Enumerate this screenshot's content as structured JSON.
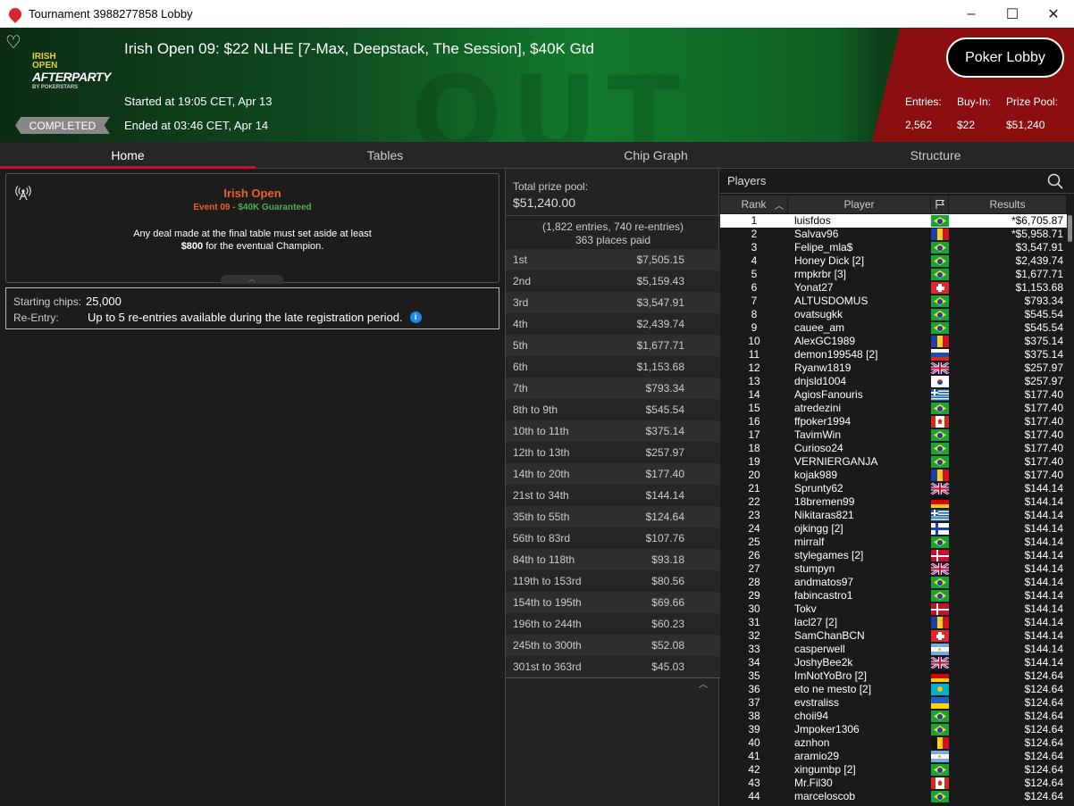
{
  "window": {
    "title": "Tournament 3988277858 Lobby",
    "controls": [
      "–",
      "☐",
      "✕"
    ]
  },
  "header": {
    "brand_line1": "IRISH",
    "brand_line2": "OPEN",
    "brand_big": "AFTERPARTY",
    "brand_small": "BY POKERSTARS",
    "status": "COMPLETED",
    "event_title": "Irish Open 09: $22 NLHE [7-Max, Deepstack, The Session], $40K Gtd",
    "started": "Started at 19:05 CET, Apr 13",
    "ended": "Ended at 03:46 CET, Apr 14",
    "lobby_button": "Poker Lobby",
    "entries_label": "Entries:",
    "entries_value": "2,562",
    "buyin_label": "Buy-In:",
    "buyin_value": "$22",
    "pool_label": "Prize Pool:",
    "pool_value": "$51,240"
  },
  "tabs": [
    "Home",
    "Tables",
    "Chip Graph",
    "Structure"
  ],
  "info": {
    "title": "Irish Open",
    "sub_a": "Event 09 - ",
    "sub_b": "$40K Guaranteed",
    "body_line1": "Any deal made at the final table must set aside at least",
    "body_amount": "$800",
    "body_line2": " for the eventual Champion.",
    "chips_label": "Starting chips:",
    "chips_value": "25,000",
    "reentry_label": "Re-Entry:",
    "reentry_value": "Up to 5 re-entries available during the late registration period."
  },
  "prizes": {
    "label": "Total prize pool:",
    "value": "$51,240.00",
    "entries_line": "(1,822 entries, 740 re-entries)",
    "places_line": "363 places paid",
    "rows": [
      {
        "place": "1st",
        "amount": "$7,505.15"
      },
      {
        "place": "2nd",
        "amount": "$5,159.43"
      },
      {
        "place": "3rd",
        "amount": "$3,547.91"
      },
      {
        "place": "4th",
        "amount": "$2,439.74"
      },
      {
        "place": "5th",
        "amount": "$1,677.71"
      },
      {
        "place": "6th",
        "amount": "$1,153.68"
      },
      {
        "place": "7th",
        "amount": "$793.34"
      },
      {
        "place": "8th to 9th",
        "amount": "$545.54"
      },
      {
        "place": "10th to 11th",
        "amount": "$375.14"
      },
      {
        "place": "12th to 13th",
        "amount": "$257.97"
      },
      {
        "place": "14th to 20th",
        "amount": "$177.40"
      },
      {
        "place": "21st to 34th",
        "amount": "$144.14"
      },
      {
        "place": "35th to 55th",
        "amount": "$124.64"
      },
      {
        "place": "56th to 83rd",
        "amount": "$107.76"
      },
      {
        "place": "84th to 118th",
        "amount": "$93.18"
      },
      {
        "place": "119th to 153rd",
        "amount": "$80.56"
      },
      {
        "place": "154th to 195th",
        "amount": "$69.66"
      },
      {
        "place": "196th to 244th",
        "amount": "$60.23"
      },
      {
        "place": "245th to 300th",
        "amount": "$52.08"
      },
      {
        "place": "301st to 363rd",
        "amount": "$45.03"
      }
    ]
  },
  "players": {
    "title": "Players",
    "col_rank": "Rank",
    "col_player": "Player",
    "col_results": "Results",
    "rows": [
      {
        "rank": "1",
        "name": "luisfdos",
        "flag": "br",
        "result": "*$6,705.87"
      },
      {
        "rank": "2",
        "name": "Salvav96",
        "flag": "ro",
        "result": "*$5,958.71"
      },
      {
        "rank": "3",
        "name": "Felipe_mla$",
        "flag": "br",
        "result": "$3,547.91"
      },
      {
        "rank": "4",
        "name": "Honey Dick [2]",
        "flag": "br",
        "result": "$2,439.74"
      },
      {
        "rank": "5",
        "name": "rmpkrbr [3]",
        "flag": "br",
        "result": "$1,677.71"
      },
      {
        "rank": "6",
        "name": "Yonat27",
        "flag": "ch",
        "result": "$1,153.68"
      },
      {
        "rank": "7",
        "name": "ALTUSDOMUS",
        "flag": "br",
        "result": "$793.34"
      },
      {
        "rank": "8",
        "name": "ovatsugkk",
        "flag": "br",
        "result": "$545.54"
      },
      {
        "rank": "9",
        "name": "cauee_am",
        "flag": "br",
        "result": "$545.54"
      },
      {
        "rank": "10",
        "name": "AlexGC1989",
        "flag": "ro",
        "result": "$375.14"
      },
      {
        "rank": "11",
        "name": "demon199548 [2]",
        "flag": "ru",
        "result": "$375.14"
      },
      {
        "rank": "12",
        "name": "Ryanw1819",
        "flag": "gb",
        "result": "$257.97"
      },
      {
        "rank": "13",
        "name": "dnjsld1004",
        "flag": "kr",
        "result": "$257.97"
      },
      {
        "rank": "14",
        "name": "AgiosFanouris",
        "flag": "gr",
        "result": "$177.40"
      },
      {
        "rank": "15",
        "name": "atredezini",
        "flag": "br",
        "result": "$177.40"
      },
      {
        "rank": "16",
        "name": "ffpoker1994",
        "flag": "ca",
        "result": "$177.40"
      },
      {
        "rank": "17",
        "name": "TavimWin",
        "flag": "br",
        "result": "$177.40"
      },
      {
        "rank": "18",
        "name": "Curioso24",
        "flag": "br",
        "result": "$177.40"
      },
      {
        "rank": "19",
        "name": "VERNIERGANJA",
        "flag": "br",
        "result": "$177.40"
      },
      {
        "rank": "20",
        "name": "kojak989",
        "flag": "ro",
        "result": "$177.40"
      },
      {
        "rank": "21",
        "name": "Sprunty62",
        "flag": "gb",
        "result": "$144.14"
      },
      {
        "rank": "22",
        "name": "18bremen99",
        "flag": "de",
        "result": "$144.14"
      },
      {
        "rank": "23",
        "name": "Nikitaras821",
        "flag": "gr",
        "result": "$144.14"
      },
      {
        "rank": "24",
        "name": "ojkingg [2]",
        "flag": "fi",
        "result": "$144.14"
      },
      {
        "rank": "25",
        "name": "mirralf",
        "flag": "br",
        "result": "$144.14"
      },
      {
        "rank": "26",
        "name": "stylegames [2]",
        "flag": "dk",
        "result": "$144.14"
      },
      {
        "rank": "27",
        "name": "stumpyn",
        "flag": "gb",
        "result": "$144.14"
      },
      {
        "rank": "28",
        "name": "andmatos97",
        "flag": "br",
        "result": "$144.14"
      },
      {
        "rank": "29",
        "name": "fabincastro1",
        "flag": "br",
        "result": "$144.14"
      },
      {
        "rank": "30",
        "name": "Tokv",
        "flag": "dk",
        "result": "$144.14"
      },
      {
        "rank": "31",
        "name": "lacl27 [2]",
        "flag": "ro",
        "result": "$144.14"
      },
      {
        "rank": "32",
        "name": "SamChanBCN",
        "flag": "ch",
        "result": "$144.14"
      },
      {
        "rank": "33",
        "name": "casperwell",
        "flag": "ar",
        "result": "$144.14"
      },
      {
        "rank": "34",
        "name": "JoshyBee2k",
        "flag": "gb",
        "result": "$144.14"
      },
      {
        "rank": "35",
        "name": "ImNotYoBro [2]",
        "flag": "de",
        "result": "$124.64"
      },
      {
        "rank": "36",
        "name": "eto ne mesto [2]",
        "flag": "kz",
        "result": "$124.64"
      },
      {
        "rank": "37",
        "name": "evstraliss",
        "flag": "ua",
        "result": "$124.64"
      },
      {
        "rank": "38",
        "name": "choii94",
        "flag": "br",
        "result": "$124.64"
      },
      {
        "rank": "39",
        "name": "Jmpoker1306",
        "flag": "br",
        "result": "$124.64"
      },
      {
        "rank": "40",
        "name": "aznhon",
        "flag": "be",
        "result": "$124.64"
      },
      {
        "rank": "41",
        "name": "aramio29",
        "flag": "ar",
        "result": "$124.64"
      },
      {
        "rank": "42",
        "name": "xingumbp [2]",
        "flag": "br",
        "result": "$124.64"
      },
      {
        "rank": "43",
        "name": "Mr.Fil30",
        "flag": "ca",
        "result": "$124.64"
      },
      {
        "rank": "44",
        "name": "marceloscob",
        "flag": "br",
        "result": "$124.64"
      }
    ]
  },
  "colors": {
    "accent_red": "#c8102e",
    "orange": "#e9622b",
    "green": "#4caf50",
    "header_red": "#8b0f10"
  }
}
